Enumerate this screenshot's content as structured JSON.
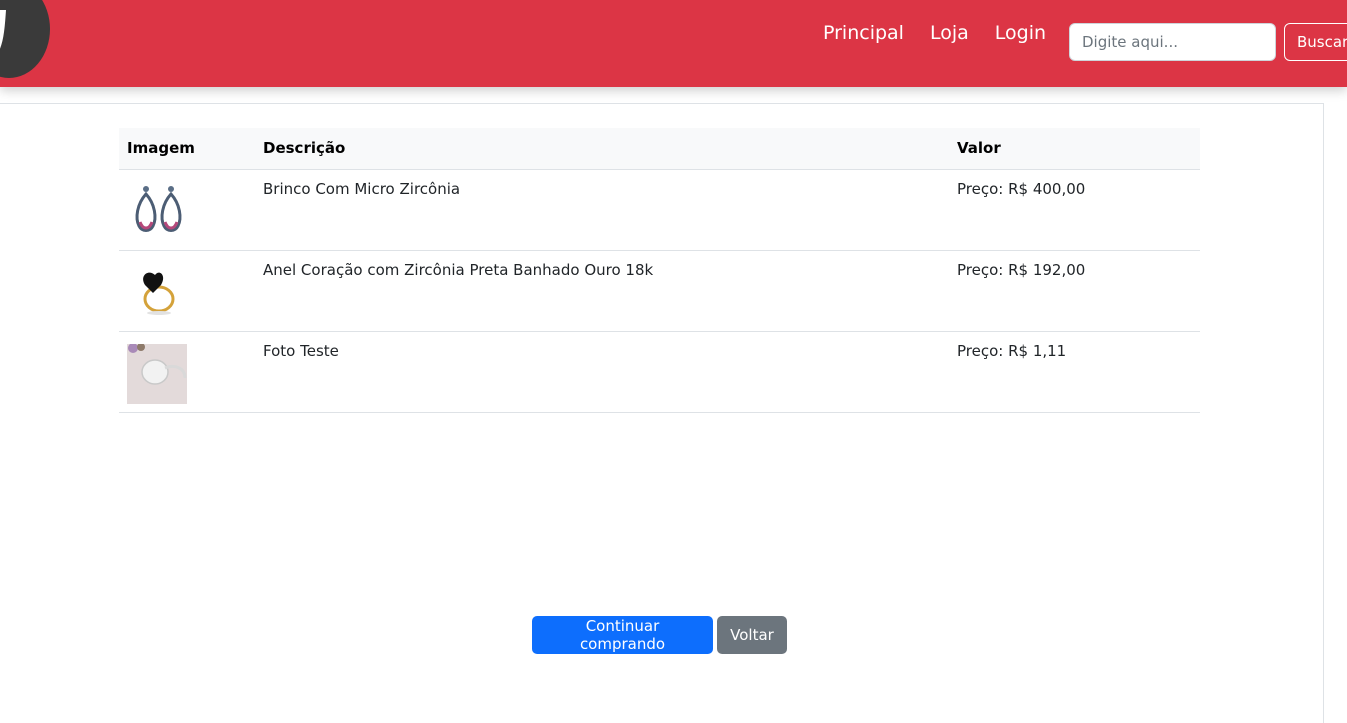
{
  "nav": {
    "links": [
      "Principal",
      "Loja",
      "Login"
    ],
    "search_placeholder": "Digite aqui...",
    "search_button": "Buscar"
  },
  "table": {
    "headers": [
      "Imagem",
      "Descrição",
      "Valor"
    ],
    "rows": [
      {
        "image_icon": "earrings-icon",
        "description": "Brinco Com Micro Zircônia",
        "price": "Preço: R$ 400,00"
      },
      {
        "image_icon": "heart-ring-icon",
        "description": "Anel Coração com Zircônia Preta Banhado Ouro 18k",
        "price": "Preço: R$ 192,00"
      },
      {
        "image_icon": "signet-ring-icon",
        "description": "Foto Teste",
        "price": "Preço: R$ 1,11"
      }
    ]
  },
  "actions": {
    "continue_label": "Continuar comprando",
    "back_label": "Voltar"
  },
  "colors": {
    "navbar": "#dc3545",
    "primary": "#0d6efd",
    "secondary": "#6c757d"
  }
}
